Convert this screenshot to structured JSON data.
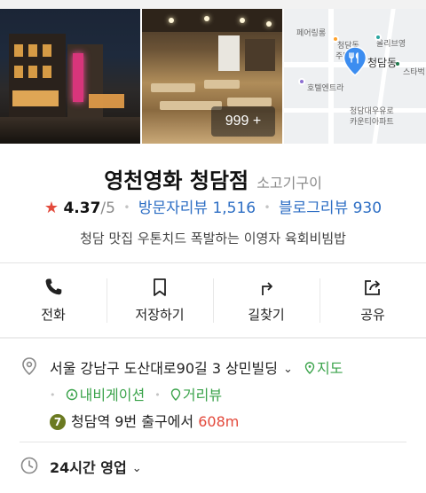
{
  "photos": {
    "more_count": "999 +"
  },
  "map": {
    "labels": [
      "페어링롱",
      "청담동",
      "주민",
      "올리브영",
      "스타벅",
      "호텔엔트라",
      "청담대우유로",
      "카운티아파트"
    ],
    "place_label": "청담동"
  },
  "place": {
    "name": "영천영화 청담점",
    "category": "소고기구이",
    "rating": "4.37",
    "rating_max": "/5",
    "visitor_reviews": "방문자리뷰 1,516",
    "blog_reviews": "블로그리뷰 930",
    "description": "청담 맛집 우톤치드 폭발하는 이영자 육회비빔밥"
  },
  "actions": [
    {
      "label": "전화",
      "icon": "phone-icon"
    },
    {
      "label": "저장하기",
      "icon": "bookmark-icon"
    },
    {
      "label": "길찾기",
      "icon": "directions-icon"
    },
    {
      "label": "공유",
      "icon": "share-icon"
    }
  ],
  "info": {
    "address": "서울 강남구 도산대로90길 3 상민빌딩",
    "map_link": "지도",
    "navigation_link": "내비게이션",
    "distance_link": "거리뷰",
    "subway_line": "7",
    "subway_text": "청담역 9번 출구에서",
    "subway_distance": "608m",
    "hours": "24시간 영업"
  },
  "colors": {
    "accent_blue": "#2d6ec4",
    "star_red": "#e34a3c",
    "link_green": "#3aa34a",
    "line7": "#6b7a21"
  }
}
